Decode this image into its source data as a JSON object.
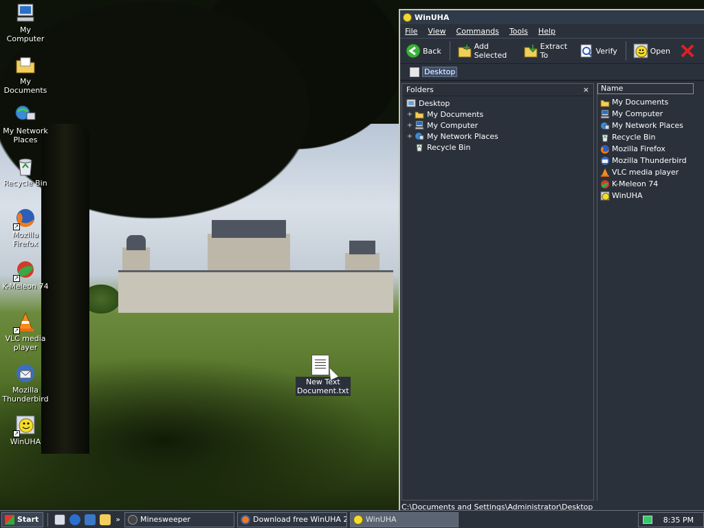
{
  "desktop": {
    "icons": [
      {
        "label": "My Computer",
        "icon": "computer-icon"
      },
      {
        "label": "My Documents",
        "icon": "folder-documents-icon"
      },
      {
        "label": "My Network Places",
        "icon": "network-icon"
      },
      {
        "label": "Recycle Bin",
        "icon": "recycle-bin-icon"
      },
      {
        "label": "Mozilla Firefox",
        "icon": "firefox-icon"
      },
      {
        "label": "K-Meleon 74",
        "icon": "kmeleon-icon"
      },
      {
        "label": "VLC media player",
        "icon": "vlc-icon"
      },
      {
        "label": "Mozilla Thunderbird",
        "icon": "thunderbird-icon"
      },
      {
        "label": "WinUHA",
        "icon": "winuha-icon"
      }
    ],
    "dragged_file": {
      "label_line1": "New Text",
      "label_line2": "Document.txt"
    }
  },
  "window": {
    "title": "WinUHA",
    "menu": [
      "File",
      "View",
      "Commands",
      "Tools",
      "Help"
    ],
    "toolbar": {
      "back": "Back",
      "add_selected": "Add Selected",
      "extract_to": "Extract To",
      "verify": "Verify",
      "open": "Open"
    },
    "address": "Desktop",
    "folders_header": "Folders",
    "folders_close": "×",
    "tree": [
      {
        "label": "Desktop",
        "expander": ""
      },
      {
        "label": "My Documents",
        "expander": "+"
      },
      {
        "label": "My Computer",
        "expander": "+"
      },
      {
        "label": "My Network Places",
        "expander": "+"
      },
      {
        "label": "Recycle Bin",
        "expander": ""
      }
    ],
    "files_header": "Name",
    "files": [
      "My Documents",
      "My Computer",
      "My Network Places",
      "Recycle Bin",
      "Mozilla Firefox",
      "Mozilla Thunderbird",
      "VLC media player",
      "K-Meleon 74",
      "WinUHA"
    ],
    "status": "C:\\Documents and Settings\\Administrator\\Desktop"
  },
  "taskbar": {
    "start": "Start",
    "quick_launch_more": "»",
    "tasks": [
      {
        "label": "Minesweeper"
      },
      {
        "label": "Download free WinUHA 2..."
      },
      {
        "label": "WinUHA"
      }
    ],
    "clock": "8:35 PM"
  },
  "colors": {
    "window_bg": "#2b313b",
    "close_x": "#e02020"
  }
}
